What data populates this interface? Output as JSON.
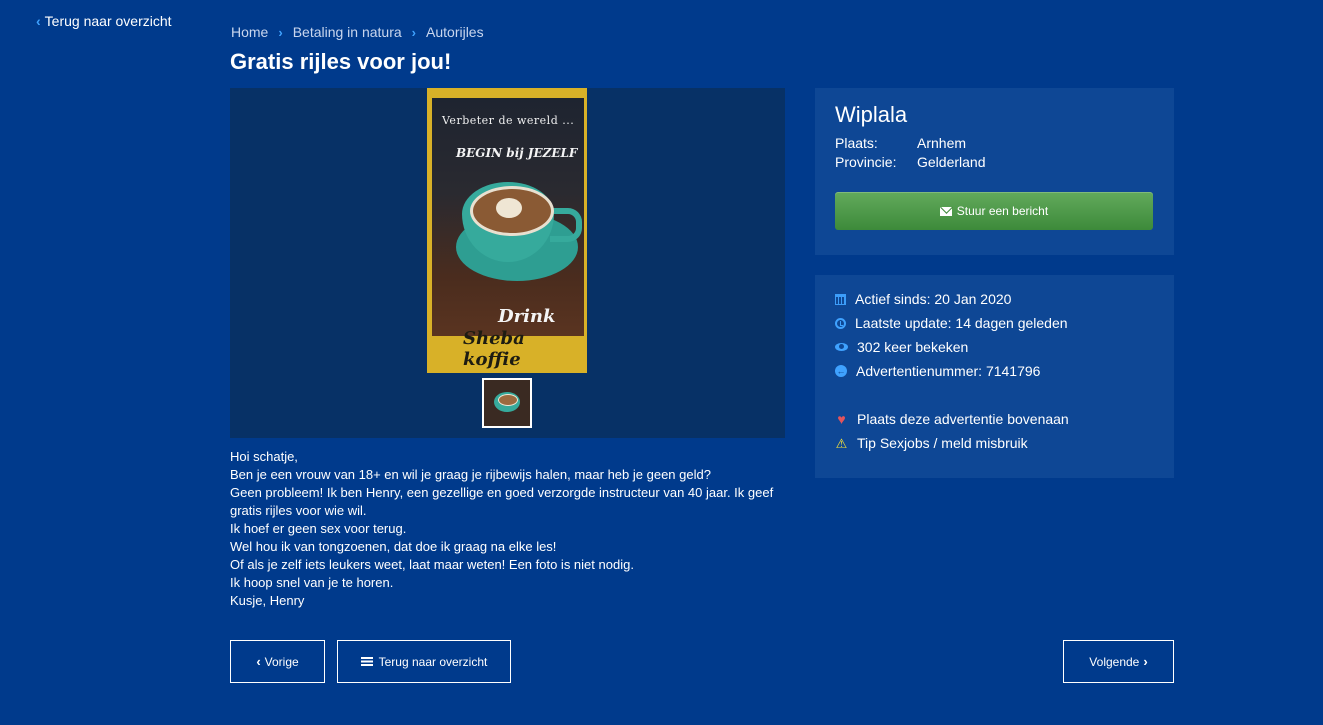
{
  "top_nav": {
    "back_label": "Terug naar overzicht"
  },
  "breadcrumb": {
    "items": [
      "Home",
      "Betaling in natura",
      "Autorijles"
    ]
  },
  "ad": {
    "title": "Gratis rijles voor jou!",
    "photo_text": {
      "line1": "Verbeter de wereld ...",
      "line2": "BEGIN bij JEZELF",
      "line3": "Drink",
      "line4": "Sheba koffie"
    },
    "description": [
      "Hoi schatje,",
      "Ben je een vrouw van 18+ en wil je graag je rijbewijs halen, maar heb je geen geld?",
      "Geen probleem! Ik ben Henry, een gezellige en goed verzorgde instructeur van 40 jaar. Ik geef gratis rijles voor wie wil.",
      "Ik hoef er geen sex voor terug.",
      "Wel hou ik van tongzoenen, dat doe ik graag na elke les!",
      "Of als je zelf iets leukers weet, laat maar weten! Een foto is niet nodig.",
      "Ik hoop snel van je te horen.",
      "Kusje, Henry"
    ]
  },
  "profile": {
    "name": "Wiplala",
    "place_label": "Plaats:",
    "place_value": "Arnhem",
    "province_label": "Provincie:",
    "province_value": "Gelderland",
    "message_button": "Stuur een bericht"
  },
  "info": {
    "active_since": "Actief sinds: 20 Jan 2020",
    "last_update": "Laatste update: 14 dagen geleden",
    "views": "302 keer bekeken",
    "ad_number": "Advertentienummer: 7141796",
    "promote": "Plaats deze advertentie bovenaan",
    "report": "Tip Sexjobs / meld misbruik"
  },
  "pager": {
    "prev": "Vorige",
    "overview": "Terug naar overzicht",
    "next": "Volgende"
  },
  "colors": {
    "background": "#003a8c",
    "card": "#0e4795",
    "accent": "#3fa2ff",
    "button_green": "#4f9b4a"
  }
}
